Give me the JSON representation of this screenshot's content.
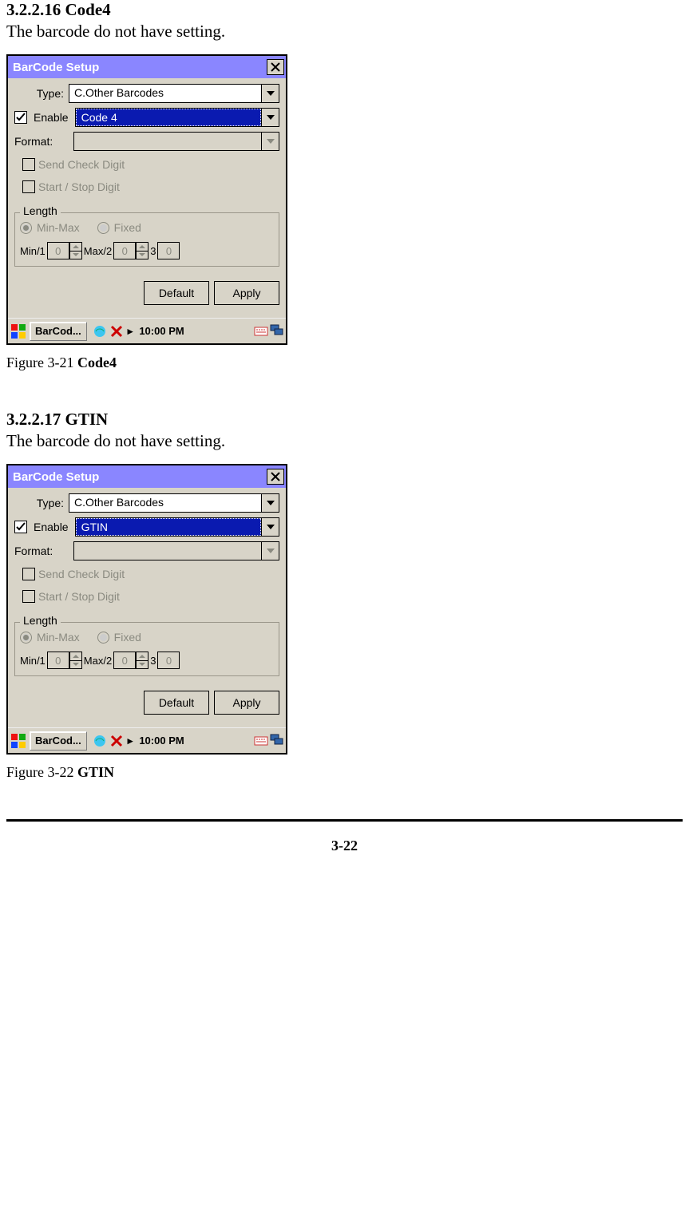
{
  "doc": {
    "sect1_heading": "3.2.2.16 Code4",
    "sect1_body": "The barcode do not have setting.",
    "fig1_caption_prefix": "Figure 3-21 ",
    "fig1_caption_bold": "Code4",
    "sect2_heading": "3.2.2.17 GTIN",
    "sect2_body": "The barcode do not have setting.",
    "fig2_caption_prefix": "Figure 3-22 ",
    "fig2_caption_bold": "GTIN",
    "page_number": "3-22"
  },
  "shot1": {
    "title": "BarCode Setup",
    "type_label": "Type:",
    "type_value": "C.Other Barcodes",
    "enable_label": "Enable",
    "enable_checked": true,
    "barcode_value": "Code 4",
    "format_label": "Format:",
    "format_value": "",
    "send_check_digit": "Send Check Digit",
    "start_stop_digit": "Start / Stop Digit",
    "length_label": "Length",
    "minmax_label": "Min-Max",
    "fixed_label": "Fixed",
    "min_label": "Min/1",
    "min_value": "0",
    "max_label": "Max/2",
    "max_value": "0",
    "field3_label": "3",
    "field3_value": "0",
    "btn_default": "Default",
    "btn_apply": "Apply",
    "task_label": "BarCod...",
    "tray_time": "10:00 PM",
    "tray_arrow": "▸"
  },
  "shot2": {
    "title": "BarCode Setup",
    "type_label": "Type:",
    "type_value": "C.Other Barcodes",
    "enable_label": "Enable",
    "enable_checked": true,
    "barcode_value": "GTIN",
    "format_label": "Format:",
    "format_value": "",
    "send_check_digit": "Send Check Digit",
    "start_stop_digit": "Start / Stop Digit",
    "length_label": "Length",
    "minmax_label": "Min-Max",
    "fixed_label": "Fixed",
    "min_label": "Min/1",
    "min_value": "0",
    "max_label": "Max/2",
    "max_value": "0",
    "field3_label": "3",
    "field3_value": "0",
    "btn_default": "Default",
    "btn_apply": "Apply",
    "task_label": "BarCod...",
    "tray_time": "10:00 PM",
    "tray_arrow": "▸"
  }
}
